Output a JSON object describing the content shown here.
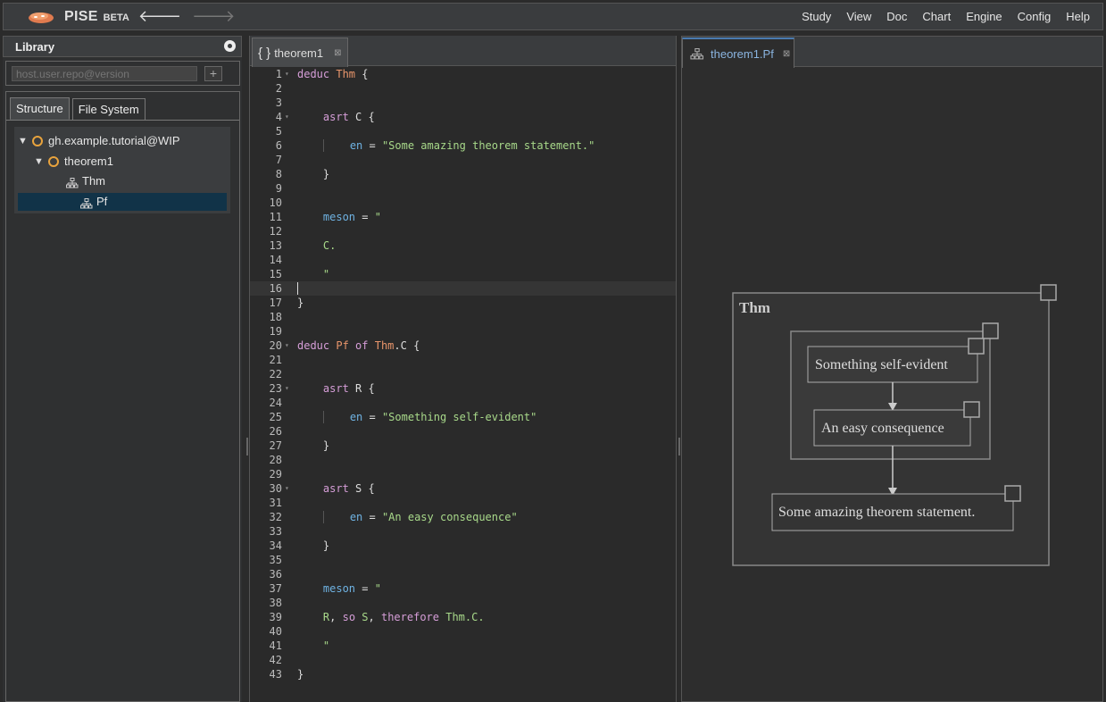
{
  "app": {
    "brand": "PISE",
    "beta": "BETA"
  },
  "menu": [
    "Study",
    "View",
    "Doc",
    "Chart",
    "Engine",
    "Config",
    "Help"
  ],
  "library": {
    "title": "Library",
    "search_placeholder": "host.user.repo@version",
    "add_label": "+",
    "tabs": [
      "Structure",
      "File System"
    ],
    "tree": [
      {
        "label": "gh.example.tutorial@WIP",
        "type": "repo"
      },
      {
        "label": "theorem1",
        "type": "module"
      },
      {
        "label": "Thm",
        "type": "deduc"
      },
      {
        "label": "Pf",
        "type": "deduc",
        "selected": true
      }
    ]
  },
  "editor": {
    "tab_label": "theorem1",
    "current_line": 16
  },
  "proof_view": {
    "tab_label": "theorem1.Pf",
    "diagram": {
      "outer_label": "Thm",
      "node_1": "Something self-evident",
      "node_2": "An easy consequence",
      "node_3": "Some amazing theorem statement."
    }
  },
  "colors": {
    "accent_orange": "#e8a33d",
    "selection": "#113348",
    "active_tab": "#4a7ab0"
  }
}
